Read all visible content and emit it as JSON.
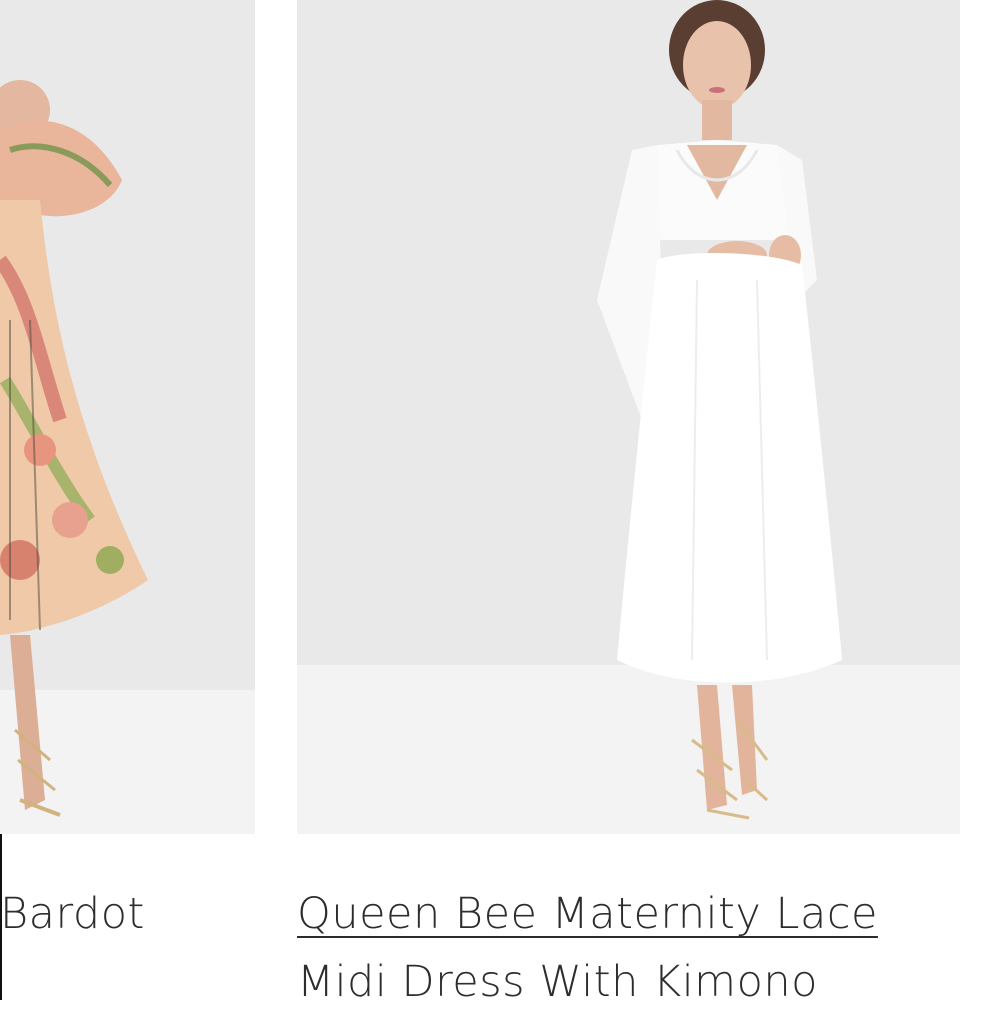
{
  "products": [
    {
      "id": "left",
      "title_fragment": "Bardot",
      "image_alt": "floral print bardot midi dress"
    },
    {
      "id": "right",
      "title_line1": "Queen Bee Maternity Lace",
      "title_line2": "Midi Dress With Kimono",
      "image_alt": "white maternity lace midi dress with kimono sleeves"
    }
  ],
  "colors": {
    "photo_background": "#e9e9ea",
    "floor": "#f4f4f4",
    "text": "#2d2d2d"
  }
}
